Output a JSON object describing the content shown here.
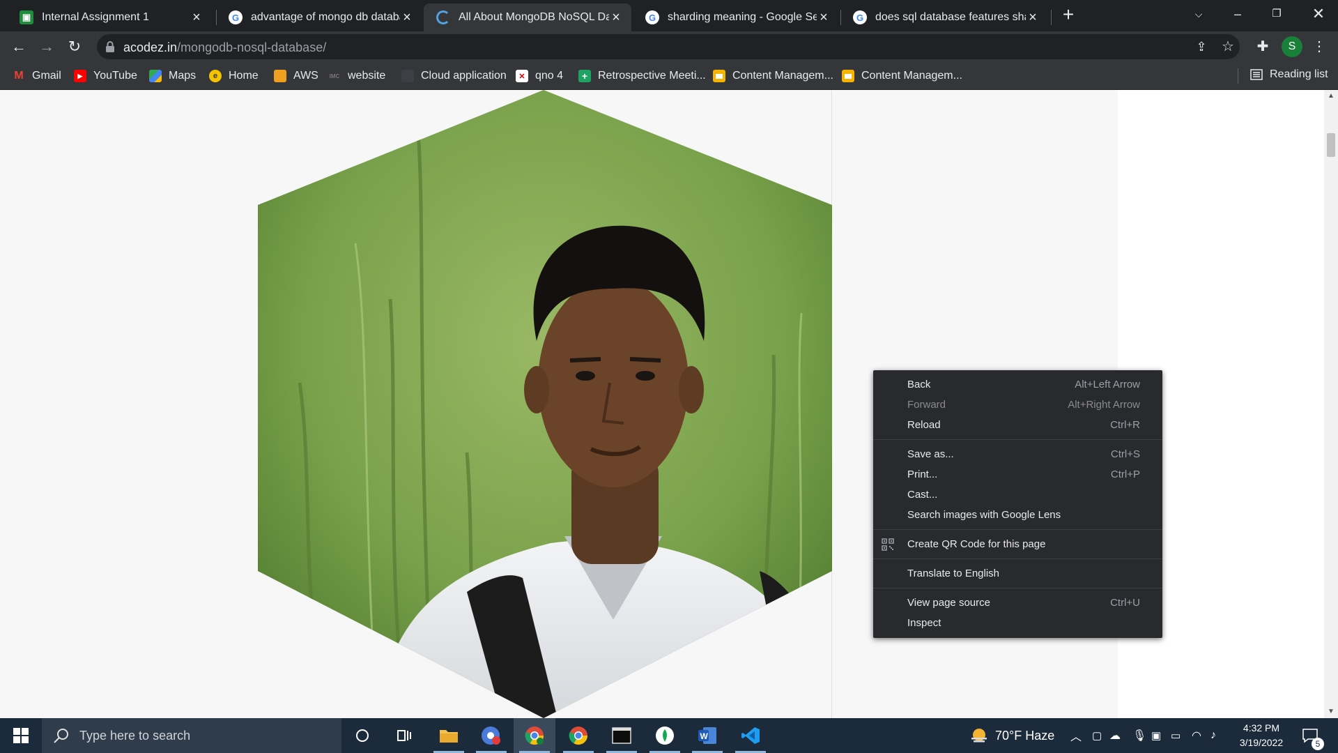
{
  "tabs": [
    {
      "title": "Internal Assignment 1",
      "icon": "classroom-icon",
      "active": false
    },
    {
      "title": "advantage of mongo db databas",
      "icon": "google-icon",
      "active": false
    },
    {
      "title": "All About MongoDB NoSQL Data",
      "icon": "acodez-icon",
      "active": true
    },
    {
      "title": "sharding meaning - Google Searc",
      "icon": "google-icon",
      "active": false
    },
    {
      "title": "does sql database features shard",
      "icon": "google-icon",
      "active": false
    }
  ],
  "address": {
    "domain": "acodez.in",
    "path": "/mongodb-nosql-database/"
  },
  "profile": {
    "initial": "S"
  },
  "bookmarks": [
    {
      "label": "Gmail",
      "icon": "gmail-icon"
    },
    {
      "label": "YouTube",
      "icon": "youtube-icon"
    },
    {
      "label": "Maps",
      "icon": "maps-icon"
    },
    {
      "label": "Home",
      "icon": "home-icon"
    },
    {
      "label": "AWS",
      "icon": "aws-icon"
    },
    {
      "label": "website",
      "icon": "website-icon"
    },
    {
      "label": "Cloud application",
      "icon": "cloud-icon"
    },
    {
      "label": "qno 4",
      "icon": "qno-icon"
    },
    {
      "label": "Retrospective Meeti...",
      "icon": "sheets-icon"
    },
    {
      "label": "Content Managem...",
      "icon": "slides-icon"
    },
    {
      "label": "Content Managem...",
      "icon": "slides-icon"
    }
  ],
  "reading_list": "Reading list",
  "context_menu": {
    "back": {
      "label": "Back",
      "shortcut": "Alt+Left Arrow"
    },
    "forward": {
      "label": "Forward",
      "shortcut": "Alt+Right Arrow"
    },
    "reload": {
      "label": "Reload",
      "shortcut": "Ctrl+R"
    },
    "save_as": {
      "label": "Save as...",
      "shortcut": "Ctrl+S"
    },
    "print": {
      "label": "Print...",
      "shortcut": "Ctrl+P"
    },
    "cast": {
      "label": "Cast..."
    },
    "lens": {
      "label": "Search images with Google Lens"
    },
    "qr": {
      "label": "Create QR Code for this page"
    },
    "translate": {
      "label": "Translate to English"
    },
    "view_source": {
      "label": "View page source",
      "shortcut": "Ctrl+U"
    },
    "inspect": {
      "label": "Inspect"
    }
  },
  "taskbar": {
    "search_placeholder": "Type here to search",
    "weather": "70°F  Haze",
    "time": "4:32 PM",
    "date": "3/19/2022",
    "notifications": "5"
  },
  "colors": {
    "chrome_dark": "#202124",
    "toolbar": "#35363a",
    "taskbar": "#1c2b3b",
    "menu": "#292a2d"
  }
}
